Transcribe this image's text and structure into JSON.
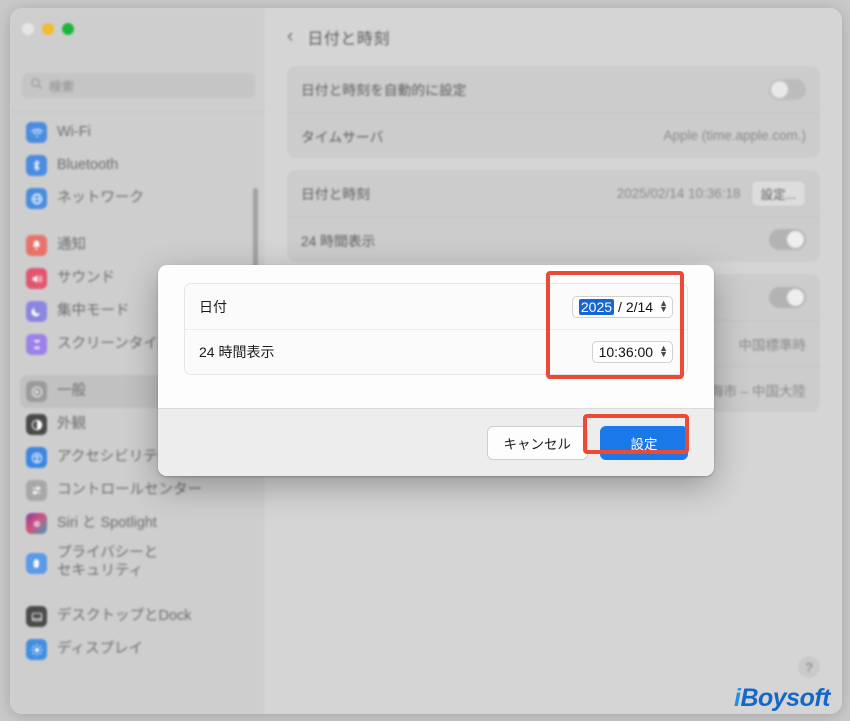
{
  "window": {
    "traffic_lights": [
      "close",
      "minimize",
      "maximize"
    ]
  },
  "sidebar": {
    "search": {
      "placeholder": "検索",
      "icon": "search-icon"
    },
    "groups": [
      {
        "items": [
          {
            "label": "Wi-Fi",
            "icon": "wifi-icon",
            "color": "#4a8ce0",
            "selected": false
          },
          {
            "label": "Bluetooth",
            "icon": "bluetooth-icon",
            "color": "#4a8ce0",
            "selected": false
          },
          {
            "label": "ネットワーク",
            "icon": "network-globe-icon",
            "color": "#4a8ce0",
            "selected": false
          }
        ]
      },
      {
        "items": [
          {
            "label": "通知",
            "icon": "bell-icon",
            "color": "#e8716b",
            "selected": false
          },
          {
            "label": "サウンド",
            "icon": "speaker-icon",
            "color": "#e0576f",
            "selected": false
          },
          {
            "label": "集中モード",
            "icon": "moon-icon",
            "color": "#8c86e0",
            "selected": false
          },
          {
            "label": "スクリーンタイム",
            "icon": "hourglass-icon",
            "color": "#9a82e8",
            "selected": false
          }
        ]
      },
      {
        "items": [
          {
            "label": "一般",
            "icon": "gear-general-icon",
            "color": "#9c9b9b",
            "selected": true
          },
          {
            "label": "外観",
            "icon": "appearance-icon",
            "color": "#4a4949",
            "selected": false
          },
          {
            "label": "アクセシビリティ",
            "icon": "accessibility-icon",
            "color": "#3a86e0",
            "selected": false
          },
          {
            "label": "コントロールセンター",
            "icon": "control-center-icon",
            "color": "#a9a8a8",
            "selected": false
          },
          {
            "label": "Siri と Spotlight",
            "icon": "siri-icon",
            "color": "#b0558a",
            "selected": false
          },
          {
            "label": "プライバシーと\nセキュリティ",
            "icon": "hand-privacy-icon",
            "color": "#5a9ae8",
            "selected": false
          }
        ]
      },
      {
        "items": [
          {
            "label": "デスクトップとDock",
            "icon": "desktop-dock-icon",
            "color": "#4b4a4a",
            "selected": false
          },
          {
            "label": "ディスプレイ",
            "icon": "display-icon",
            "color": "#3f8fe0",
            "selected": false
          }
        ]
      }
    ]
  },
  "main": {
    "back_label": "‹",
    "title": "日付と時刻",
    "rows": [
      {
        "label": "日付と時刻を自動的に設定",
        "control": "toggle",
        "state": "off"
      },
      {
        "label": "タイムサーバ",
        "value": "Apple (time.apple.com.)"
      },
      {
        "label": "日付と時刻",
        "value": "2025/02/14 10:36:18",
        "button": "設定..."
      },
      {
        "label": "24 時間表示",
        "control": "toggle",
        "state": "on"
      }
    ],
    "hidden_rows": [
      {
        "label": "",
        "control": "toggle",
        "state": "on"
      },
      {
        "label": "",
        "value": "中国標準時"
      },
      {
        "label": "",
        "value": "上海市 – 中国大陸"
      }
    ],
    "help_label": "?"
  },
  "sheet": {
    "rows": [
      {
        "label": "日付",
        "field": {
          "selected_segment": "2025",
          "rest": "/ 2/14",
          "stepper": true
        }
      },
      {
        "label": "24 時間表示",
        "field": {
          "selected_segment": "",
          "rest": "10:36:00",
          "stepper": true
        }
      }
    ],
    "buttons": {
      "cancel": "キャンセル",
      "confirm": "設定"
    }
  },
  "annotations": {
    "color": "#ec4a37",
    "boxes": [
      "date-time-fields",
      "confirm-button"
    ]
  },
  "watermark": {
    "prefix": "i",
    "text": "Boysoft",
    "color": "#1668c6"
  }
}
